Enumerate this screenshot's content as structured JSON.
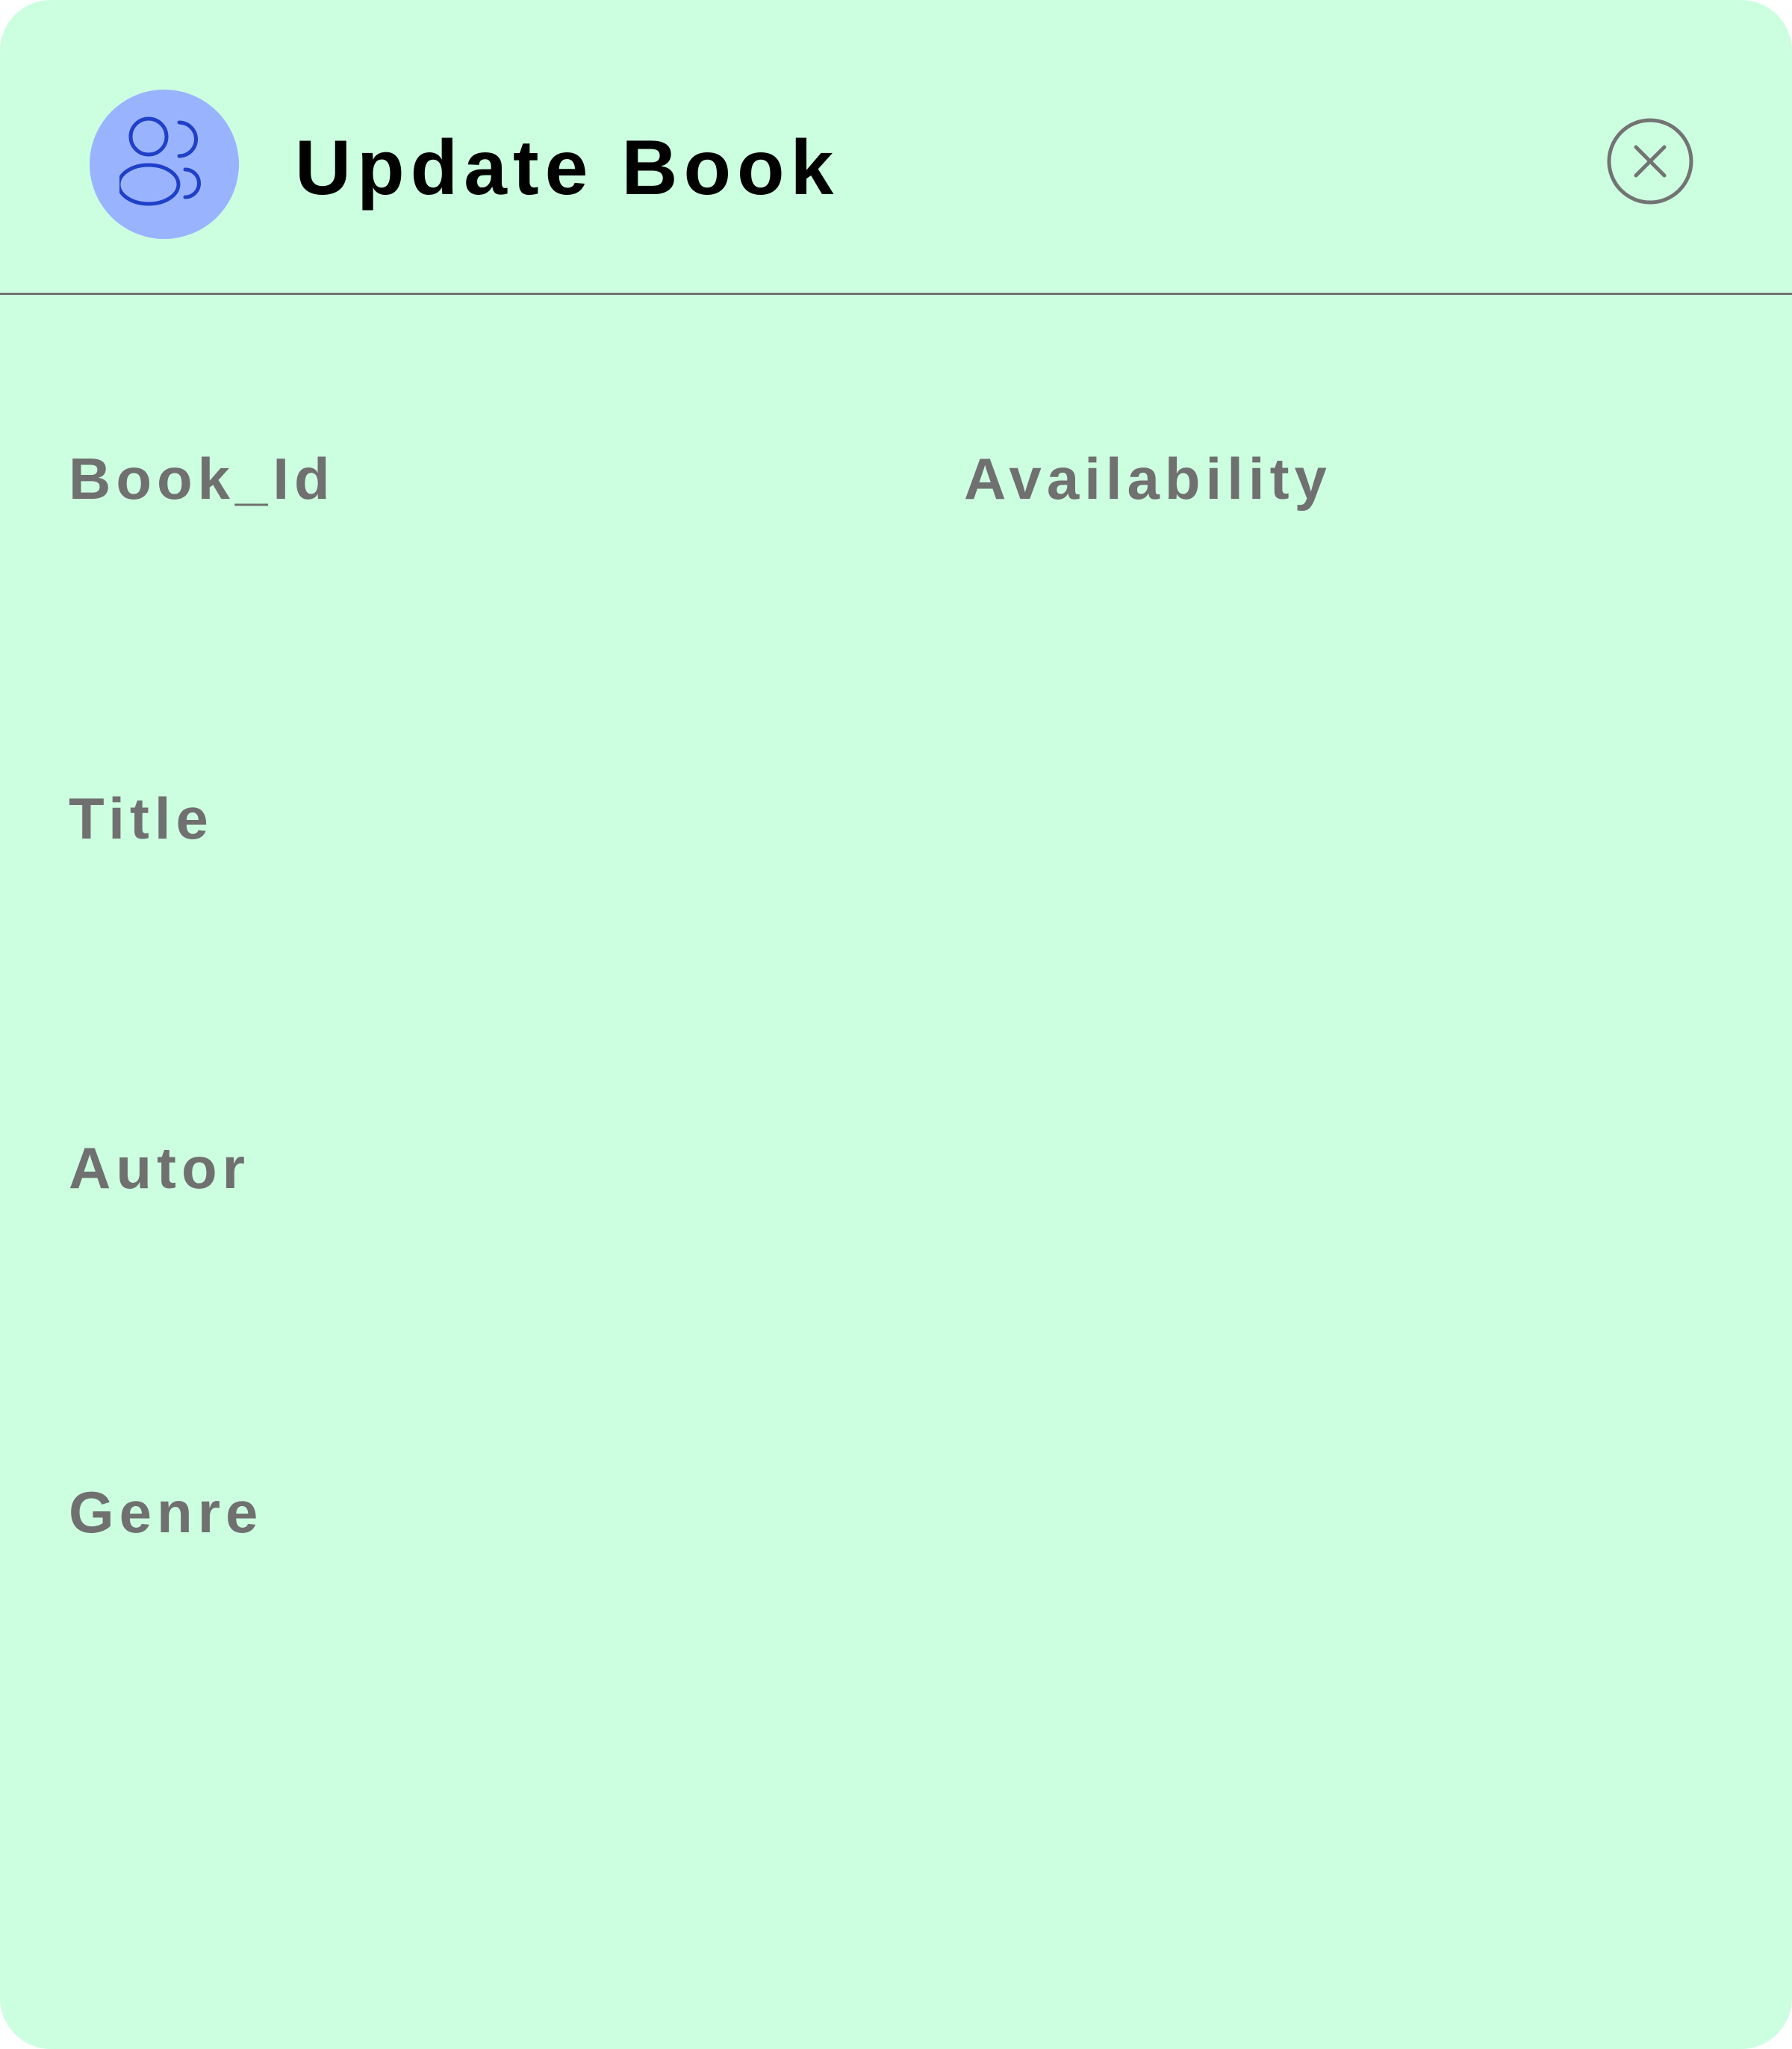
{
  "dialog": {
    "title": "Update Book",
    "avatar_icon": "users-icon",
    "close_icon": "close-circle-icon",
    "colors": {
      "background": "#ccffe0",
      "avatar_bg": "#99b3ff",
      "avatar_icon": "#1f40c8",
      "title": "#000000",
      "label": "#707070",
      "divider": "#737373",
      "close_icon": "#737373"
    }
  },
  "form": {
    "book_id": {
      "label": "Book_Id",
      "value": ""
    },
    "availability": {
      "label": "Availability",
      "value": ""
    },
    "title": {
      "label": "Title",
      "value": ""
    },
    "autor": {
      "label": "Autor",
      "value": ""
    },
    "genre": {
      "label": "Genre",
      "value": ""
    }
  }
}
